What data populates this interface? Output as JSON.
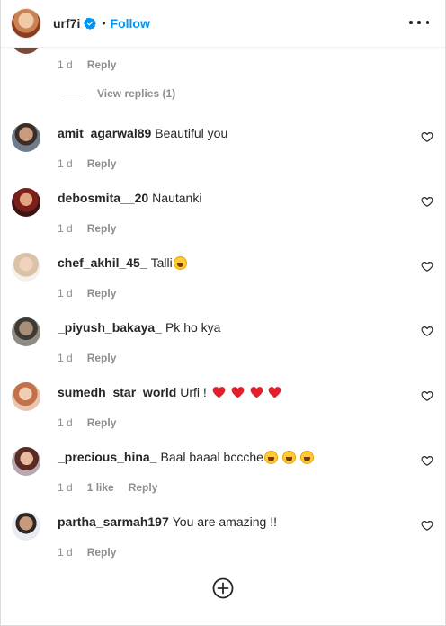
{
  "header": {
    "username": "urf7i",
    "separator": "•",
    "follow_label": "Follow"
  },
  "top_comment": {
    "time": "1 d",
    "reply_label": "Reply",
    "view_replies": "View replies (1)"
  },
  "comments": [
    {
      "username": "amit_agarwal89",
      "text": "Beautiful you",
      "time": "1 d",
      "likes": "",
      "reply_label": "Reply"
    },
    {
      "username": "debosmita__20",
      "text": "Nautanki",
      "time": "1 d",
      "likes": "",
      "reply_label": "Reply"
    },
    {
      "username": "chef_akhil_45_",
      "text": "Talli",
      "emoji": "😂",
      "time": "1 d",
      "likes": "",
      "reply_label": "Reply"
    },
    {
      "username": "_piyush_bakaya_",
      "text": "Pk ho kya",
      "time": "1 d",
      "likes": "",
      "reply_label": "Reply"
    },
    {
      "username": "sumedh_star_world",
      "text": "Urfi !",
      "emoji": "❤❤❤❤",
      "time": "1 d",
      "likes": "",
      "reply_label": "Reply"
    },
    {
      "username": "_precious_hina_",
      "text": "Baal baaal bccche",
      "emoji": "😂😂😂",
      "time": "1 d",
      "likes": "1 like",
      "reply_label": "Reply"
    },
    {
      "username": "partha_sarmah197",
      "text": "You are amazing !!",
      "time": "1 d",
      "likes": "",
      "reply_label": "Reply"
    }
  ],
  "colors": {
    "accent": "#0095f6",
    "text": "#262626",
    "muted": "#8e8e8e",
    "heart_emoji": "#e0202a"
  }
}
